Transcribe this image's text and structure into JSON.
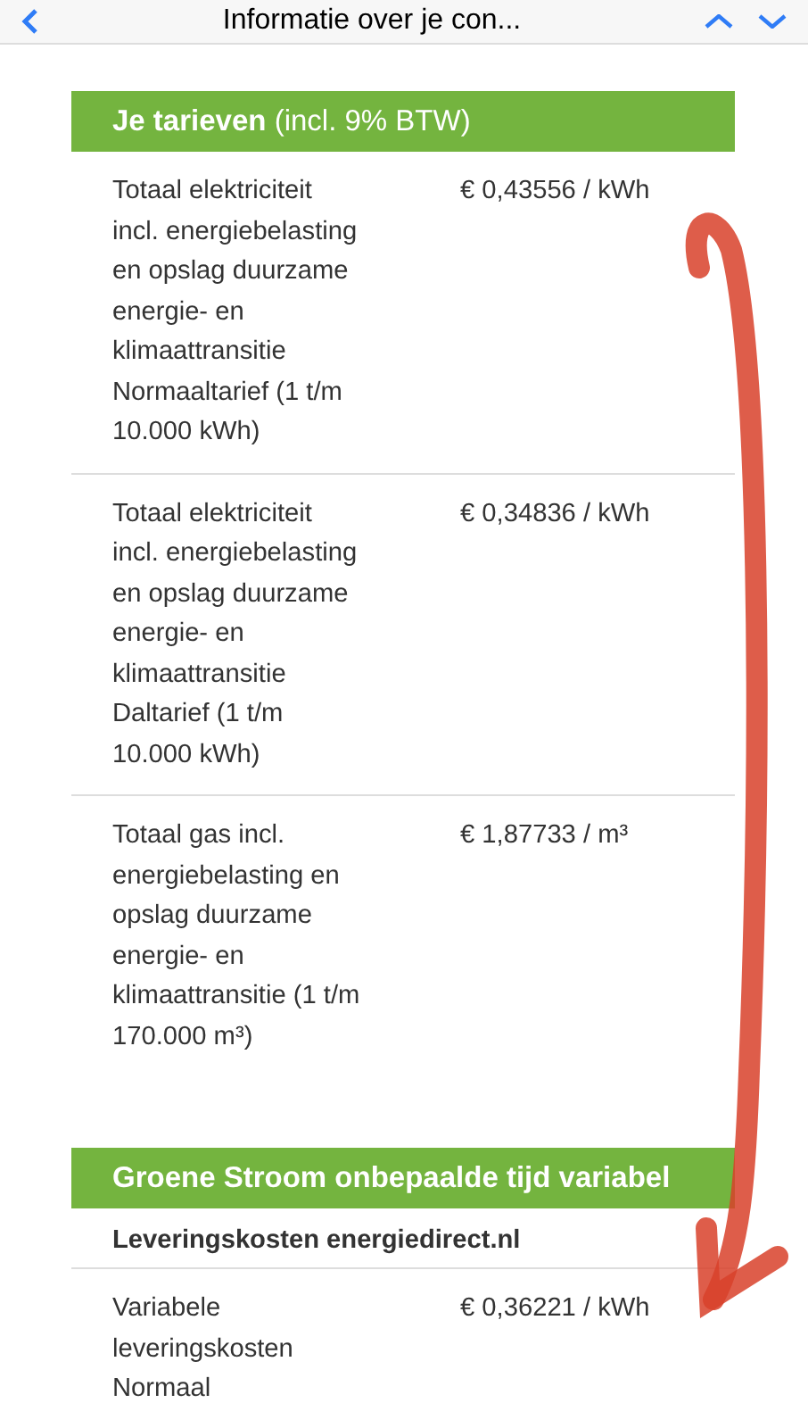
{
  "nav_bar": {
    "title": "Informatie over je con..."
  },
  "sections": [
    {
      "title": "Je tarieven",
      "title_note": "(incl. 9% BTW)",
      "rows": [
        {
          "kind": "price",
          "label": "Totaal elektriciteit incl. energiebelasting en opslag duurzame energie- en klimaattransitie Normaaltarief (1 t/m 10.000 kWh)",
          "value": "€ 0,43556 / kWh"
        },
        {
          "kind": "price",
          "label": "Totaal elektriciteit incl. energiebelasting en opslag duurzame energie- en klimaattransitie Daltarief (1 t/m 10.000 kWh)",
          "value": "€ 0,34836 / kWh"
        },
        {
          "kind": "price",
          "label": "Totaal gas incl. energiebelasting en opslag duurzame energie- en klimaattransitie (1 t/m 170.000 m³)",
          "value": "€ 1,87733 / m³"
        }
      ]
    },
    {
      "title": "Groene Stroom onbepaalde tijd variabel",
      "rows": [
        {
          "kind": "subheading",
          "label": "Leveringskosten energiedirect.nl"
        },
        {
          "kind": "price",
          "label": "Variabele leveringskosten Normaal",
          "value": "€ 0,36221 / kWh"
        }
      ]
    }
  ]
}
